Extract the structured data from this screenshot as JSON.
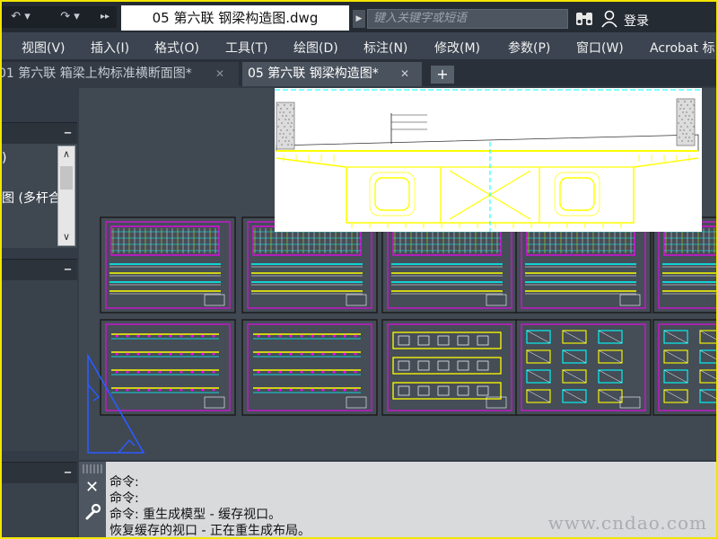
{
  "titlebar": {
    "doc_title": "05 第六联 钢梁构造图.dwg",
    "search_placeholder": "键入关键字或短语",
    "login_label": "登录",
    "qat_icons": [
      "undo-icon",
      "redo-icon",
      "expand-icon"
    ]
  },
  "menu": {
    "items": [
      "视图(V)",
      "插入(I)",
      "格式(O)",
      "工具(T)",
      "绘图(D)",
      "标注(N)",
      "修改(M)",
      "参数(P)",
      "窗口(W)",
      "Acrobat 标"
    ]
  },
  "tabs": {
    "items": [
      {
        "label": "01 第六联 箱梁上构标准横断面图*",
        "active": false
      },
      {
        "label": "05 第六联 钢梁构造图*",
        "active": true
      }
    ],
    "close_glyph": "✕",
    "add_glyph": "+"
  },
  "palettes": {
    "close_glyph": "–",
    "palette1_lines": [
      ")",
      "图 (多杆合"
    ]
  },
  "command": {
    "lines": [
      "命令:",
      "命令:",
      "命令:  重生成模型 - 缓存视口。",
      "恢复缓存的视口 - 正在重生成布局。"
    ],
    "close_glyph": "✕"
  },
  "watermark": "www.cndao.com",
  "colors": {
    "cad_yellow": "#ffff00",
    "cad_magenta": "#ff00ff",
    "cad_cyan": "#00ffff",
    "cad_white": "#ffffff",
    "ucs_blue": "#2a5cff"
  }
}
